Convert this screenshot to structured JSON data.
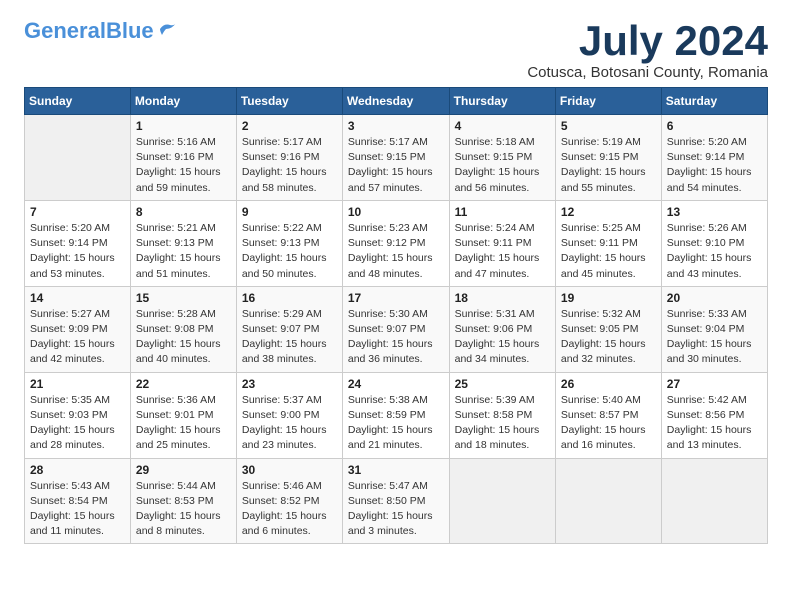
{
  "header": {
    "logo_general": "General",
    "logo_blue": "Blue",
    "month": "July 2024",
    "location": "Cotusca, Botosani County, Romania"
  },
  "days_of_week": [
    "Sunday",
    "Monday",
    "Tuesday",
    "Wednesday",
    "Thursday",
    "Friday",
    "Saturday"
  ],
  "weeks": [
    [
      {
        "day": "",
        "sunrise": "",
        "sunset": "",
        "daylight": ""
      },
      {
        "day": "1",
        "sunrise": "Sunrise: 5:16 AM",
        "sunset": "Sunset: 9:16 PM",
        "daylight": "Daylight: 15 hours and 59 minutes."
      },
      {
        "day": "2",
        "sunrise": "Sunrise: 5:17 AM",
        "sunset": "Sunset: 9:16 PM",
        "daylight": "Daylight: 15 hours and 58 minutes."
      },
      {
        "day": "3",
        "sunrise": "Sunrise: 5:17 AM",
        "sunset": "Sunset: 9:15 PM",
        "daylight": "Daylight: 15 hours and 57 minutes."
      },
      {
        "day": "4",
        "sunrise": "Sunrise: 5:18 AM",
        "sunset": "Sunset: 9:15 PM",
        "daylight": "Daylight: 15 hours and 56 minutes."
      },
      {
        "day": "5",
        "sunrise": "Sunrise: 5:19 AM",
        "sunset": "Sunset: 9:15 PM",
        "daylight": "Daylight: 15 hours and 55 minutes."
      },
      {
        "day": "6",
        "sunrise": "Sunrise: 5:20 AM",
        "sunset": "Sunset: 9:14 PM",
        "daylight": "Daylight: 15 hours and 54 minutes."
      }
    ],
    [
      {
        "day": "7",
        "sunrise": "Sunrise: 5:20 AM",
        "sunset": "Sunset: 9:14 PM",
        "daylight": "Daylight: 15 hours and 53 minutes."
      },
      {
        "day": "8",
        "sunrise": "Sunrise: 5:21 AM",
        "sunset": "Sunset: 9:13 PM",
        "daylight": "Daylight: 15 hours and 51 minutes."
      },
      {
        "day": "9",
        "sunrise": "Sunrise: 5:22 AM",
        "sunset": "Sunset: 9:13 PM",
        "daylight": "Daylight: 15 hours and 50 minutes."
      },
      {
        "day": "10",
        "sunrise": "Sunrise: 5:23 AM",
        "sunset": "Sunset: 9:12 PM",
        "daylight": "Daylight: 15 hours and 48 minutes."
      },
      {
        "day": "11",
        "sunrise": "Sunrise: 5:24 AM",
        "sunset": "Sunset: 9:11 PM",
        "daylight": "Daylight: 15 hours and 47 minutes."
      },
      {
        "day": "12",
        "sunrise": "Sunrise: 5:25 AM",
        "sunset": "Sunset: 9:11 PM",
        "daylight": "Daylight: 15 hours and 45 minutes."
      },
      {
        "day": "13",
        "sunrise": "Sunrise: 5:26 AM",
        "sunset": "Sunset: 9:10 PM",
        "daylight": "Daylight: 15 hours and 43 minutes."
      }
    ],
    [
      {
        "day": "14",
        "sunrise": "Sunrise: 5:27 AM",
        "sunset": "Sunset: 9:09 PM",
        "daylight": "Daylight: 15 hours and 42 minutes."
      },
      {
        "day": "15",
        "sunrise": "Sunrise: 5:28 AM",
        "sunset": "Sunset: 9:08 PM",
        "daylight": "Daylight: 15 hours and 40 minutes."
      },
      {
        "day": "16",
        "sunrise": "Sunrise: 5:29 AM",
        "sunset": "Sunset: 9:07 PM",
        "daylight": "Daylight: 15 hours and 38 minutes."
      },
      {
        "day": "17",
        "sunrise": "Sunrise: 5:30 AM",
        "sunset": "Sunset: 9:07 PM",
        "daylight": "Daylight: 15 hours and 36 minutes."
      },
      {
        "day": "18",
        "sunrise": "Sunrise: 5:31 AM",
        "sunset": "Sunset: 9:06 PM",
        "daylight": "Daylight: 15 hours and 34 minutes."
      },
      {
        "day": "19",
        "sunrise": "Sunrise: 5:32 AM",
        "sunset": "Sunset: 9:05 PM",
        "daylight": "Daylight: 15 hours and 32 minutes."
      },
      {
        "day": "20",
        "sunrise": "Sunrise: 5:33 AM",
        "sunset": "Sunset: 9:04 PM",
        "daylight": "Daylight: 15 hours and 30 minutes."
      }
    ],
    [
      {
        "day": "21",
        "sunrise": "Sunrise: 5:35 AM",
        "sunset": "Sunset: 9:03 PM",
        "daylight": "Daylight: 15 hours and 28 minutes."
      },
      {
        "day": "22",
        "sunrise": "Sunrise: 5:36 AM",
        "sunset": "Sunset: 9:01 PM",
        "daylight": "Daylight: 15 hours and 25 minutes."
      },
      {
        "day": "23",
        "sunrise": "Sunrise: 5:37 AM",
        "sunset": "Sunset: 9:00 PM",
        "daylight": "Daylight: 15 hours and 23 minutes."
      },
      {
        "day": "24",
        "sunrise": "Sunrise: 5:38 AM",
        "sunset": "Sunset: 8:59 PM",
        "daylight": "Daylight: 15 hours and 21 minutes."
      },
      {
        "day": "25",
        "sunrise": "Sunrise: 5:39 AM",
        "sunset": "Sunset: 8:58 PM",
        "daylight": "Daylight: 15 hours and 18 minutes."
      },
      {
        "day": "26",
        "sunrise": "Sunrise: 5:40 AM",
        "sunset": "Sunset: 8:57 PM",
        "daylight": "Daylight: 15 hours and 16 minutes."
      },
      {
        "day": "27",
        "sunrise": "Sunrise: 5:42 AM",
        "sunset": "Sunset: 8:56 PM",
        "daylight": "Daylight: 15 hours and 13 minutes."
      }
    ],
    [
      {
        "day": "28",
        "sunrise": "Sunrise: 5:43 AM",
        "sunset": "Sunset: 8:54 PM",
        "daylight": "Daylight: 15 hours and 11 minutes."
      },
      {
        "day": "29",
        "sunrise": "Sunrise: 5:44 AM",
        "sunset": "Sunset: 8:53 PM",
        "daylight": "Daylight: 15 hours and 8 minutes."
      },
      {
        "day": "30",
        "sunrise": "Sunrise: 5:46 AM",
        "sunset": "Sunset: 8:52 PM",
        "daylight": "Daylight: 15 hours and 6 minutes."
      },
      {
        "day": "31",
        "sunrise": "Sunrise: 5:47 AM",
        "sunset": "Sunset: 8:50 PM",
        "daylight": "Daylight: 15 hours and 3 minutes."
      },
      {
        "day": "",
        "sunrise": "",
        "sunset": "",
        "daylight": ""
      },
      {
        "day": "",
        "sunrise": "",
        "sunset": "",
        "daylight": ""
      },
      {
        "day": "",
        "sunrise": "",
        "sunset": "",
        "daylight": ""
      }
    ]
  ]
}
